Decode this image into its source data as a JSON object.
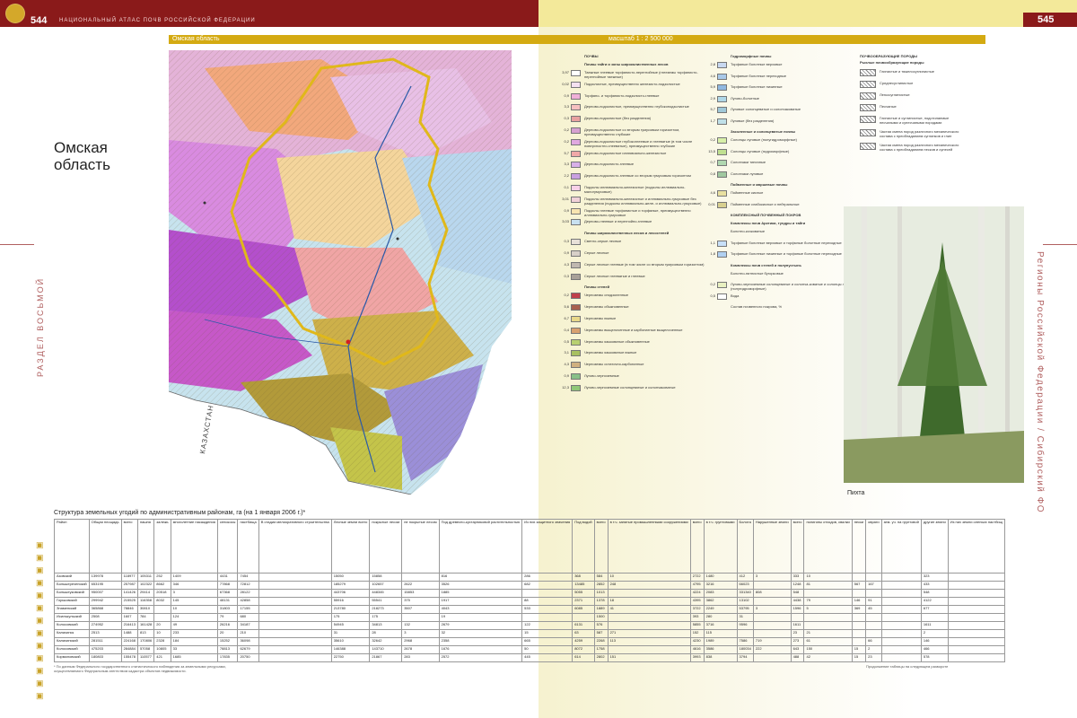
{
  "header": {
    "left_page_number": "544",
    "right_page_number": "545",
    "left_running_title": "НАЦИОНАЛЬНЫЙ АТЛАС ПОЧВ РОССИЙСКОЙ ФЕДЕРАЦИИ"
  },
  "map": {
    "region_label": "Омская область",
    "scale": "масштаб 1 : 2 500 000",
    "title": "Омская область",
    "country_label": "КАЗАХСТАН"
  },
  "side": {
    "left": "РАЗДЕЛ ВОСЬМОЙ",
    "right": "Регионы Российской Федерации / Сибирский ФО"
  },
  "legend": {
    "col1": [
      {
        "h": "ПОЧВЫ"
      },
      {
        "h": "Почвы тайги и зоны широколиственных лесов"
      },
      {
        "v": "3,97",
        "c": "#ffffff",
        "t": "Таежные глеевые торфянисто-перегнойные (глееземы торфянисто-перегнойные таежные)"
      },
      {
        "v": "0,02",
        "c": "#f4e0f0",
        "t": "Подзолистые, преимущественно железисто-подзолистые"
      },
      {
        "v": "0,9",
        "c": "#f0b0d8",
        "t": "Торфяно- и торфянисто-подзолисто-глеевые"
      },
      {
        "v": "3,3",
        "c": "#f7c0c0",
        "t": "Дерново-подзолистые, преимущественно глубокоподзолистые"
      },
      {
        "v": "0,3",
        "c": "#e8a0a0",
        "t": "Дерново-подзолистые (без разделения)"
      },
      {
        "v": "0,2",
        "c": "#d6a0d0",
        "t": "Дерново-подзолистые со вторым гумусовым горизонтом, преимущественно глубокие"
      },
      {
        "v": "0,2",
        "c": "#e0a8e0",
        "t": "Дерново-подзолистые глубокоглеевые и глееватые (в том числе поверхностно-глееватые), преимущественно глубокие"
      },
      {
        "v": "5,7",
        "c": "#f0a8a8",
        "t": "Дерново-подзолистые иллювиально-железистые"
      },
      {
        "v": "3,3",
        "c": "#d8b0e8",
        "t": "Дерново-подзолисто-глеевые"
      },
      {
        "v": "2,2",
        "c": "#c9a0e0",
        "t": "Дерново-подзолисто-глеевые со вторым гумусовым горизонтом"
      },
      {
        "v": "0,1",
        "c": "#f8d0e8",
        "t": "Подзолы иллювиально-железистые (подзолы иллювиально-малогумусовые)"
      },
      {
        "v": "3,01",
        "c": "#f0d0d8",
        "t": "Подзолы иллювиально-железистые и иллювиально-гумусовые без разделения (подзолы иллювиально-желе- и иллювиально-гумусовые)"
      },
      {
        "v": "0,9",
        "c": "#f8e4b0",
        "t": "Подзолы глеевые торфянистые и торфяные, преимущественно иллювиально-гумусовые"
      },
      {
        "v": "3,03",
        "c": "#c8e0f0",
        "t": "Дерново-глеевые и перегнойно-глеевые"
      },
      {
        "h": "Почвы широколиственных лесов и лесостепей"
      },
      {
        "v": "0,3",
        "c": "#e8e0d8",
        "t": "Светло-серые лесные"
      },
      {
        "v": "0,9",
        "c": "#d8d0c8",
        "t": "Серые лесные"
      },
      {
        "v": "4,3",
        "c": "#c0b8b0",
        "t": "Серые лесные глеевые (в том числе со вторым гумусовым горизонтом)"
      },
      {
        "v": "0,3",
        "c": "#a8a098",
        "t": "Серые лесные глееватые и глеевые"
      },
      {
        "h": "Почвы степей"
      },
      {
        "v": "0,2",
        "c": "#c0404a",
        "t": "Черноземы оподзоленные"
      },
      {
        "v": "5,6",
        "c": "#a86050",
        "t": "Черноземы обыкновенные"
      },
      {
        "v": "6,7",
        "c": "#e8d88a",
        "t": "Черноземы южные"
      },
      {
        "v": "0,4",
        "c": "#d8a070",
        "t": "Черноземы выщелоченные и карбонатные выщелоченные"
      },
      {
        "v": "0,5",
        "c": "#b8d070",
        "t": "Черноземы языковатые обыкновенные"
      },
      {
        "v": "3,1",
        "c": "#a8c060",
        "t": "Черноземы языковатые южные"
      },
      {
        "v": "4,3",
        "c": "#d0b080",
        "t": "Черноземы остаточно-карбонатные"
      },
      {
        "v": "0,9",
        "c": "#88c088",
        "t": "Лугово-черноземные"
      },
      {
        "v": "12,3",
        "c": "#90c878",
        "t": "Лугово-черноземные солонцеватые и солончаковатые"
      }
    ],
    "col2": [
      {
        "h": "Гидроморфные почвы"
      },
      {
        "v": "2,8",
        "c": "#c8d8f0",
        "t": "Торфяные болотные верховые"
      },
      {
        "v": "4,6",
        "c": "#a8c8e8",
        "t": "Торфяные болотные переходные"
      },
      {
        "v": "5,9",
        "c": "#90b8e0",
        "t": "Торфяные болотные низинные"
      },
      {
        "v": "2,9",
        "c": "#b0d8e8",
        "t": "Лугово-болотные"
      },
      {
        "v": "5,7",
        "c": "#a0c8d8",
        "t": "Луговые солонцеватые и солончаковатые"
      },
      {
        "v": "1,7",
        "c": "#c0e0e8",
        "t": "Луговые (без разделения)"
      },
      {
        "h": "Засоленные и солонцеватые почвы"
      },
      {
        "v": "0,2",
        "c": "#d8f0a8",
        "t": "Солонцы луговые (полугидроморфные)"
      },
      {
        "v": "13,5",
        "c": "#c0e090",
        "t": "Солонцы луговые (гидроморфные)"
      },
      {
        "v": "0,7",
        "c": "#b0d8b0",
        "t": "Солончаки типичные"
      },
      {
        "v": "0,8",
        "c": "#a0c8a0",
        "t": "Солончаки луговые"
      },
      {
        "h": "Пойменные и маршевые почвы"
      },
      {
        "v": "4,6",
        "c": "#e8e0a0",
        "t": "Пойменные кислые"
      },
      {
        "v": "0,01",
        "c": "#d8d090",
        "t": "Пойменные слабокислые и нейтральные"
      },
      {
        "h": "КОМПЛЕКСНЫЙ ПОЧВЕННЫЙ ПОКРОВ"
      },
      {
        "h": "Комплексы почв Арктики, тундры и тайги"
      },
      {
        "t": "Болотно-кочковатые"
      },
      {
        "v": "1,1",
        "c": "#c8e0f8",
        "t": "Торфяные болотные верховые и торфяные болотные переходные"
      },
      {
        "v": "1,8",
        "c": "#b0d0f0",
        "t": "Торфяные болотные низинные и торфяные болотные переходные"
      },
      {
        "h": "Комплексы почв степей и полупустынь"
      },
      {
        "t": "Болотно-пятнистые бугорковые"
      },
      {
        "v": "0,2",
        "c": "#e8f0c0",
        "t": "Лугово-черноземные солонцеватые и солонча-коватые и солонцы луговые (полугидроморфные)"
      },
      {
        "v": "0,5",
        "c": "#ffffff",
        "t": "Вода"
      },
      {
        "t": "Состав почвенного покрова, %"
      }
    ],
    "col3_title": "ПОЧВООБРАЗУЮЩИЕ ПОРОДЫ",
    "col3_sub": "Рыхлые почвообразующие породы",
    "col3": [
      "Глинистые и тяжелосуглинистые",
      "Среднесуглинистые",
      "Легкосуглинистые",
      "Песчаные",
      "Глинистые и суглинистые, подстилаемые песчаными и супесчаными породами",
      "Частая смена пород различного механического состава с преобладанием суглинков и глин",
      "Частая смена пород различного механического состава с преобладанием песков и супесей"
    ]
  },
  "photo": {
    "caption": "Пихта"
  },
  "table": {
    "title": "Структура земельных угодий по административным районам, га (на 1 января 2006 г.)*",
    "headers": [
      "Район",
      "Общая площадь",
      "всего",
      "пашня",
      "залежь",
      "многолетние насаждения",
      "сенокосы",
      "пастбища",
      "В стадии мелиоративного строительства",
      "Лесные земли всего",
      "покрытые лесом",
      "не покрытые лесом",
      "Под древесно-кустарниковой растительностью",
      "Из них защитного значения",
      "Под водой",
      "всего",
      "в т.ч. занятые промышленными сооружениями",
      "всего",
      "в т.ч. грунтовыми",
      "Болота",
      "Нарушенные земли",
      "всего",
      "полигоны отходов, свалки",
      "пески",
      "овраги",
      "зем. уч. на грунтовой",
      "другие земли",
      "Из них земли оленьих пастбищ"
    ],
    "rows": [
      [
        "Азовский",
        "139978",
        "118977",
        "105311",
        "252",
        "1409",
        "4431",
        "7454",
        "",
        "15050",
        "15858",
        "",
        "816",
        "286",
        "368",
        "584",
        "10",
        "2722",
        "1480",
        "412",
        "3",
        "333",
        "10",
        "",
        "",
        "",
        "323",
        ""
      ],
      [
        "Большереченский",
        "653195",
        "257987",
        "102322",
        "8662",
        "346",
        "77868",
        "72812",
        "",
        "185279",
        "102657",
        "2622",
        "3526",
        "682",
        "13485",
        "2852",
        "248",
        "4795",
        "3216",
        "66023",
        "",
        "1248",
        "81",
        "567",
        "167",
        "",
        "433",
        ""
      ],
      [
        "Большеуковский",
        "950007",
        "141426",
        "29414",
        "20518",
        "3",
        "67368",
        "28122",
        "",
        "443706",
        "448345",
        "15853",
        "1885",
        "",
        "5055",
        "1013",
        "",
        "4224",
        "2083",
        "331340",
        "808",
        "548",
        "",
        "",
        "",
        "",
        "548",
        ""
      ],
      [
        "Горьковский",
        "299942",
        "215525",
        "116358",
        "8032",
        "145",
        "48131",
        "42858",
        "",
        "55916",
        "55541",
        "375",
        "1917",
        "88",
        "2371",
        "1378",
        "18",
        "4395",
        "3862",
        "13102",
        "",
        "4438",
        "79",
        "146",
        "91",
        "",
        "4122",
        ""
      ],
      [
        "Знаменский",
        "365868",
        "78846",
        "30810",
        "",
        "10",
        "31803",
        "17155",
        "",
        "213780",
        "218273",
        "3507",
        "4043",
        "533",
        "6085",
        "1889",
        "41",
        "3722",
        "2249",
        "53795",
        "3",
        "1596",
        "5",
        "369",
        "45",
        "",
        "677",
        ""
      ],
      [
        "Исилькульский",
        "2508",
        "1607",
        "784",
        "",
        "124",
        "79",
        "680",
        "",
        "175",
        "175",
        "",
        "19",
        "",
        "",
        "1500",
        "",
        "393",
        "280",
        "31",
        "",
        "",
        "",
        "",
        "",
        "",
        "",
        ""
      ],
      [
        "Колосовский",
        "274952",
        "216413",
        "161428",
        "20",
        "49",
        "26216",
        "34187",
        "",
        "54945",
        "34813",
        "132",
        "2679",
        "122",
        "6131",
        "576",
        "",
        "5855",
        "3716",
        "9596",
        "",
        "1611",
        "",
        "",
        "",
        "",
        "1611",
        ""
      ],
      [
        "Калачинск",
        "2513",
        "1488",
        "813",
        "10",
        "233",
        "20",
        "210",
        "",
        "31",
        "28",
        "3",
        "32",
        "15",
        "63",
        "587",
        "271",
        "152",
        "115",
        "",
        "",
        "23",
        "21",
        "",
        "",
        "",
        "2",
        ""
      ],
      [
        "Калачинский",
        "281511",
        "224168",
        "170806",
        "2328",
        "184",
        "15252",
        "36098",
        "",
        "35610",
        "32642",
        "2968",
        "2358",
        "665",
        "4259",
        "2268",
        "113",
        "4230",
        "1989",
        "7586",
        "719",
        "273",
        "61",
        "",
        "66",
        "",
        "146",
        ""
      ],
      [
        "Колосовский",
        "475203",
        "284884",
        "57058",
        "10805",
        "33",
        "78813",
        "62679",
        "",
        "146388",
        "143710",
        "2678",
        "1676",
        "50",
        "8072",
        "1758",
        "",
        "4616",
        "3586",
        "180034",
        "222",
        "643",
        "150",
        "15",
        "2",
        "",
        "466",
        ""
      ],
      [
        "Кормиловский",
        "180803",
        "155478",
        "110577",
        "421",
        "1685",
        "17835",
        "20750",
        "",
        "22750",
        "21867",
        "283",
        "2572",
        "445",
        "614",
        "2802",
        "151",
        "3993",
        "838",
        "3794",
        "",
        "488",
        "42",
        "15",
        "23",
        "",
        "578",
        ""
      ]
    ],
    "footnote": "* По данным Федерального государственного статистического наблюдения за земельными ресурсами, осуществляемого Федеральным агентством кадастра объектов недвижимости.",
    "continuation": "Продолжение таблицы на следующем развороте"
  }
}
